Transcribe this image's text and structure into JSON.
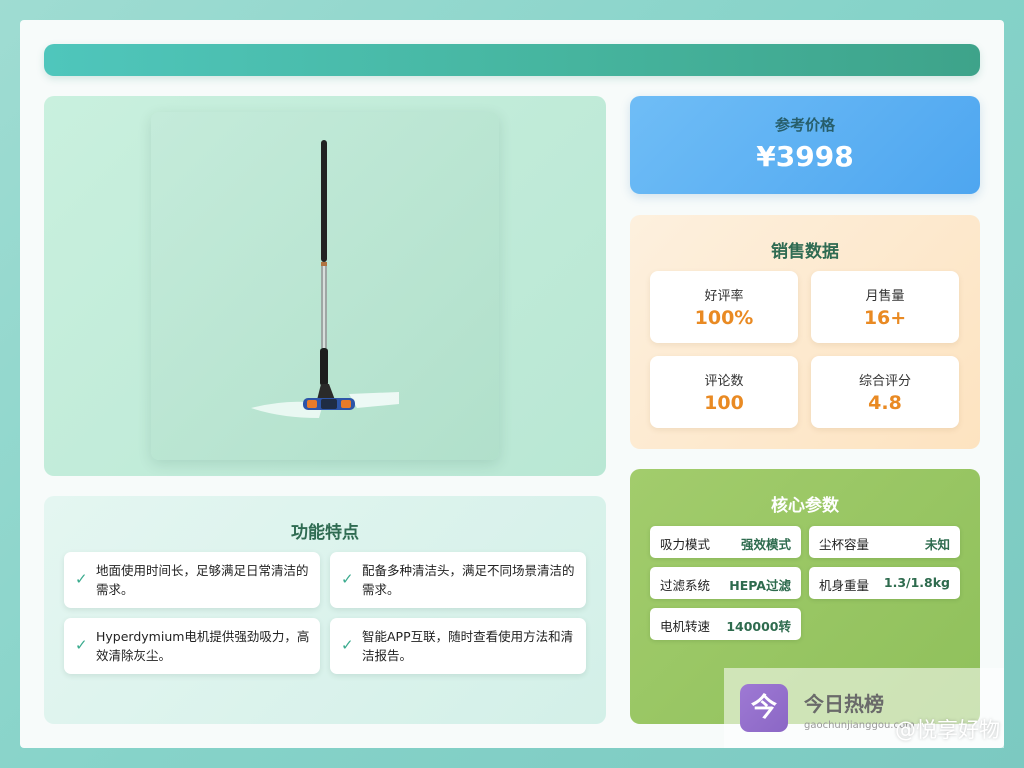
{
  "price": {
    "label": "参考价格",
    "value": "¥3998"
  },
  "sales": {
    "title": "销售数据",
    "stats": [
      {
        "label": "好评率",
        "value": "100%"
      },
      {
        "label": "月售量",
        "value": "16+"
      },
      {
        "label": "评论数",
        "value": "100"
      },
      {
        "label": "综合评分",
        "value": "4.8"
      }
    ]
  },
  "features": {
    "title": "功能特点",
    "items": [
      "地面使用时间长，足够满足日常清洁的需求。",
      "配备多种清洁头，满足不同场景清洁的需求。",
      "Hyperdymium电机提供强劲吸力，高效清除灰尘。",
      "智能APP互联，随时查看使用方法和清洁报告。"
    ]
  },
  "specs": {
    "title": "核心参数",
    "items": [
      {
        "key": "吸力模式",
        "value": "强效模式"
      },
      {
        "key": "尘杯容量",
        "value": "未知"
      },
      {
        "key": "过滤系统",
        "value": "HEPA过滤"
      },
      {
        "key": "机身重量",
        "value": "1.3/1.8kg"
      },
      {
        "key": "电机转速",
        "value": "140000转"
      }
    ]
  },
  "watermark": {
    "logo_char": "今",
    "title": "今日热榜",
    "url": "gaochunjianggou.com",
    "brand": "@悦享好物"
  },
  "colors": {
    "accent_teal": "#46b59f",
    "price_blue": "#4ea6f0",
    "stat_orange": "#e98a23",
    "spec_green": "#8fc05b"
  },
  "icons": {
    "feature_bullet": "check-icon"
  }
}
